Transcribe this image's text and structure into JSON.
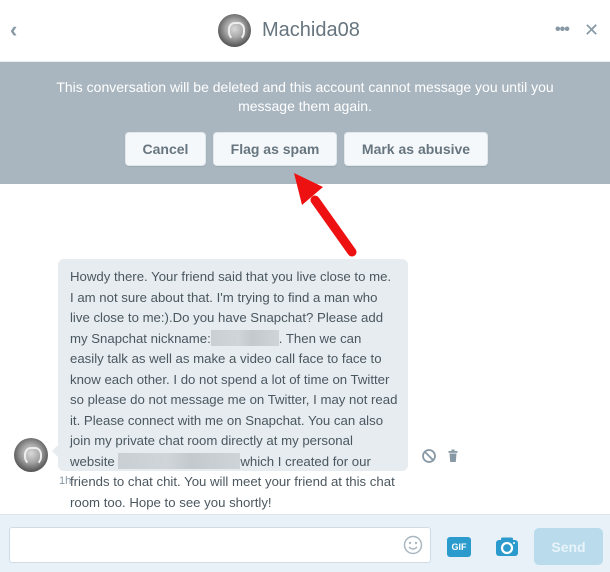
{
  "header": {
    "back_icon": "chevron-left-icon",
    "back_glyph": "‹",
    "username": "Machida08",
    "more_glyph": "•••",
    "close_glyph": "✕"
  },
  "banner": {
    "message": "This conversation will be deleted and this account cannot message you until you message them again.",
    "buttons": {
      "cancel": "Cancel",
      "flag_spam": "Flag as spam",
      "mark_abusive": "Mark as abusive"
    },
    "background": "#a9b6bf"
  },
  "annotation": {
    "type": "red-arrow",
    "points_to": "Flag as spam",
    "color": "#ee1111"
  },
  "message": {
    "part1": "Howdy there. Your friend said that you live close to me. I am not sure about that. I'm trying to find a man who live close to me:).Do you have Snapchat? Please add my Snapchat nickname:",
    "part2": ". Then we can easily talk as well as make a video call face to face to know each other. I do not spend a lot of time on Twitter so please do not message me on Twitter, I may not read it. Please connect with me on Snapchat. You can also join my private chat room directly at my personal website ",
    "part3": "which I created for our friends to chat chit. You will meet your friend at this chat room too. Hope to see you shortly!",
    "redacted": [
      "snapchat-nickname",
      "website-url"
    ],
    "timestamp": "1h",
    "actions": [
      "block-icon",
      "trash-icon"
    ]
  },
  "composer": {
    "input_value": "",
    "input_placeholder": "",
    "gif_label": "GIF",
    "send_label": "Send",
    "accent": "#2b9acd"
  }
}
